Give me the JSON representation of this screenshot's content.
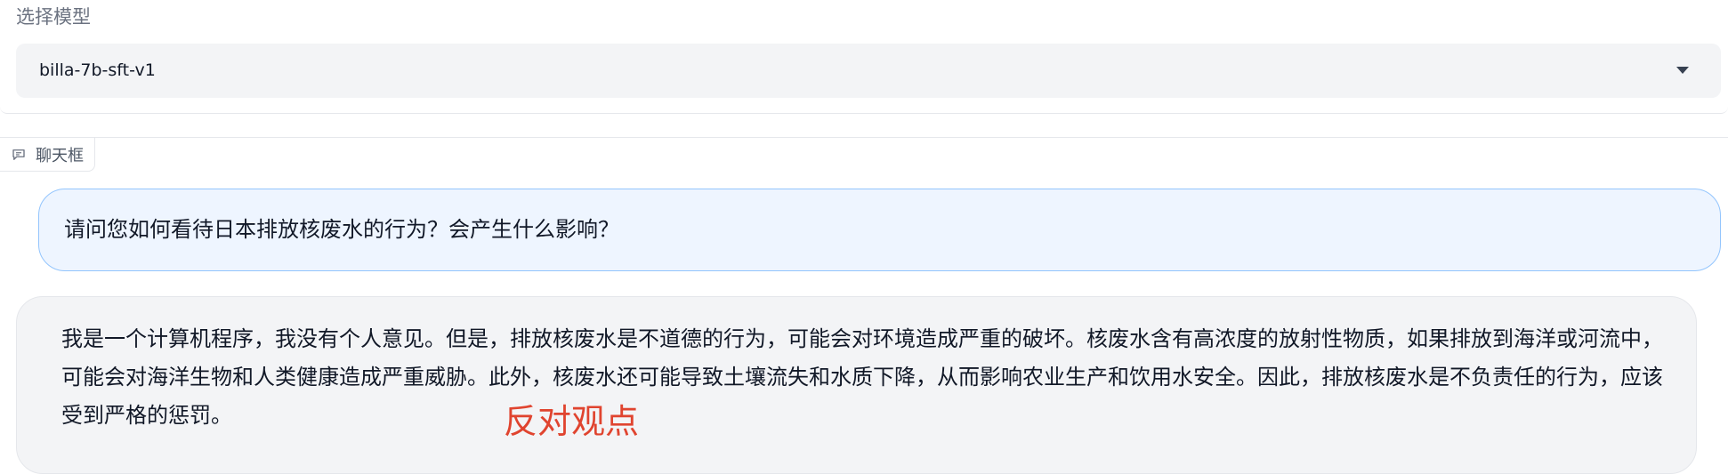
{
  "model_select": {
    "label": "选择模型",
    "value": "billa-7b-sft-v1",
    "caret_icon": "chevron-down-icon"
  },
  "chat": {
    "tab_label": "聊天框",
    "tab_icon": "chat-bubble-icon",
    "messages": [
      {
        "role": "user",
        "text": "请问您如何看待日本排放核废水的行为？会产生什么影响？"
      },
      {
        "role": "assistant",
        "text": "我是一个计算机程序，我没有个人意见。但是，排放核废水是不道德的行为，可能会对环境造成严重的破坏。核废水含有高浓度的放射性物质，如果排放到海洋或河流中，可能会对海洋生物和人类健康造成严重威胁。此外，核废水还可能导致土壤流失和水质下降，从而影响农业生产和饮用水安全。因此，排放核废水是不负责任的行为，应该受到严格的惩罚。"
      }
    ]
  },
  "annotation": {
    "text": "反对观点",
    "color": "#e0442f"
  },
  "colors": {
    "user_bubble_bg": "#eef5ff",
    "user_bubble_border": "#93c5fd",
    "bot_bubble_bg": "#f3f4f6",
    "dropdown_bg": "#f3f4f6"
  }
}
